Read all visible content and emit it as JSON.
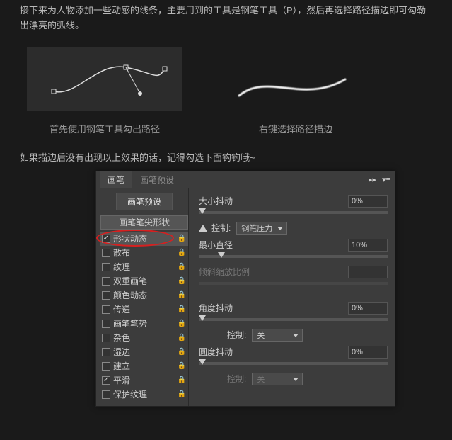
{
  "intro": "接下来为人物添加一些动感的线条，主要用到的工具是钢笔工具（P），然后再选择路径描边即可勾勒出漂亮的弧线。",
  "examples": {
    "left_caption": "首先使用钢笔工具勾出路径",
    "right_caption": "右键选择路径描边"
  },
  "note": "如果描边后没有出现以上效果的话，记得勾选下面钩钩哦~",
  "panel": {
    "tabs": {
      "brush": "画笔",
      "presets": "画笔预设"
    },
    "preset_button": "画笔预设",
    "sidebar": {
      "tip_shape": "画笔笔尖形状",
      "items": [
        {
          "label": "形状动态",
          "checked": true,
          "locked": true,
          "selected": true
        },
        {
          "label": "散布",
          "checked": false,
          "locked": true
        },
        {
          "label": "纹理",
          "checked": false,
          "locked": true
        },
        {
          "label": "双重画笔",
          "checked": false,
          "locked": true
        },
        {
          "label": "颜色动态",
          "checked": false,
          "locked": true
        },
        {
          "label": "传递",
          "checked": false,
          "locked": true
        },
        {
          "label": "画笔笔势",
          "checked": false,
          "locked": true
        },
        {
          "label": "杂色",
          "checked": false,
          "locked": true
        },
        {
          "label": "湿边",
          "checked": false,
          "locked": true
        },
        {
          "label": "建立",
          "checked": false,
          "locked": true
        },
        {
          "label": "平滑",
          "checked": true,
          "locked": true
        },
        {
          "label": "保护纹理",
          "checked": false,
          "locked": true
        }
      ]
    },
    "settings": {
      "size_jitter": {
        "label": "大小抖动",
        "value": "0%"
      },
      "control": {
        "label": "控制:",
        "value": "钢笔压力"
      },
      "min_diameter": {
        "label": "最小直径",
        "value": "10%"
      },
      "tilt_scale": {
        "label": "倾斜缩放比例"
      },
      "angle_jitter": {
        "label": "角度抖动",
        "value": "0%"
      },
      "angle_control": {
        "label": "控制:",
        "value": "关"
      },
      "roundness_jitter": {
        "label": "圆度抖动",
        "value": "0%"
      },
      "round_control": {
        "label": "控制:",
        "value": "关"
      }
    }
  }
}
